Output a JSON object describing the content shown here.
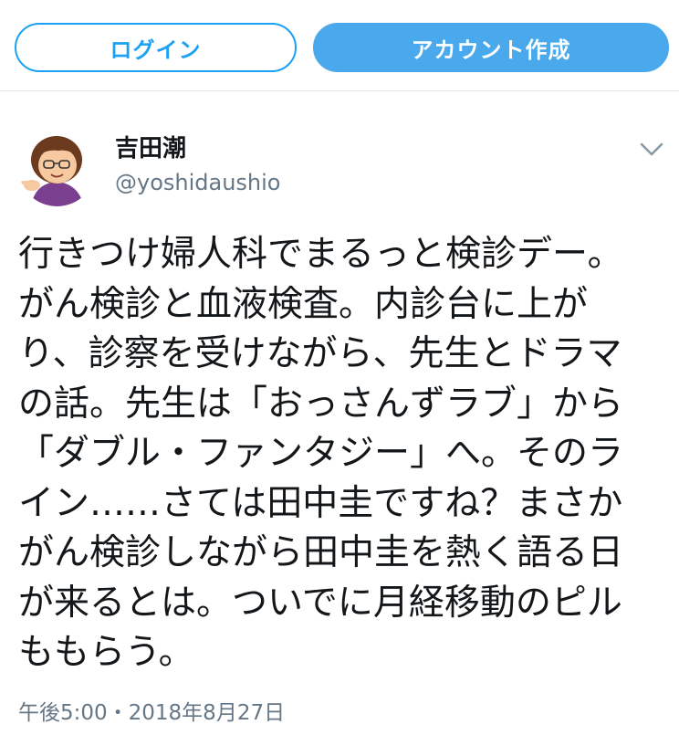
{
  "header": {
    "login_label": "ログイン",
    "signup_label": "アカウント作成"
  },
  "tweet": {
    "display_name": "吉田潮",
    "screen_name": "@yoshidaushio",
    "avatar_icon": "cartoon-avatar-icon",
    "menu_icon": "chevron-down-icon",
    "text": "行きつけ婦人科でまるっと検診デー。\nがん検診と血液検査。内診台に上が\nり、診察を受けながら、先生とドラマ\nの話。先生は「おっさんずラブ」から\n「ダブル・ファンタジー」へ。そのラ\nイン……さては田中圭ですね？まさか\nがん検診しながら田中圭を熱く語る日\nが来るとは。ついでに月経移動のピル\nももらう。",
    "timestamp": "午後5:00・2018年8月27日"
  },
  "colors": {
    "accent": "#1da1f2",
    "signup_bg": "#4aa8ec",
    "text": "#14171a",
    "muted": "#657786",
    "divider": "#e1e8ed"
  }
}
